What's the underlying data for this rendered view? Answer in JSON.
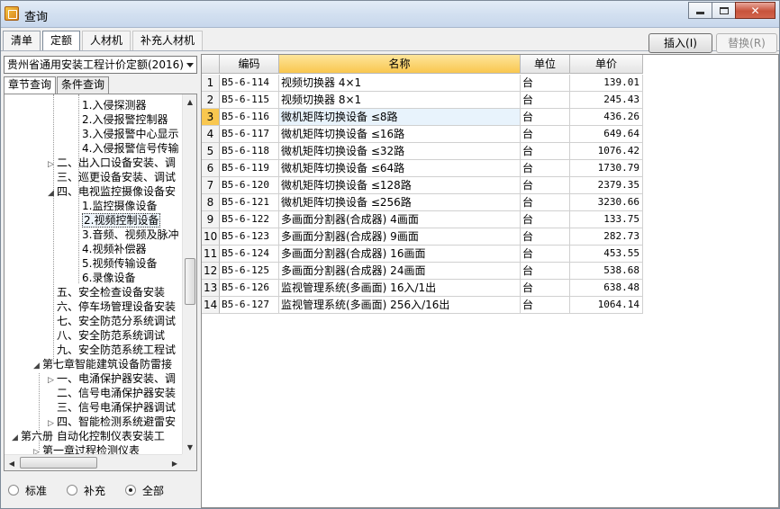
{
  "window": {
    "title": "查询"
  },
  "top_tabs": [
    "清单",
    "定额",
    "人材机",
    "补充人材机"
  ],
  "active_top_tab": "定额",
  "buttons": {
    "insert": "插入(I)",
    "replace": "替换(R)"
  },
  "left": {
    "quota_select": "贵州省通用安装工程计价定额(2016)",
    "tabs": [
      "章节查询",
      "条件查询"
    ],
    "active_tab": "章节查询",
    "tree": [
      "1.入侵探测器",
      "2.入侵报警控制器",
      "3.入侵报警中心显示",
      "4.入侵报警信号传输",
      "二、出入口设备安装、调",
      "三、巡更设备安装、调试",
      "四、电视监控摄像设备安",
      "1.监控摄像设备",
      "2.视频控制设备",
      "3.音频、视频及脉冲",
      "4.视频补偿器",
      "5.视频传输设备",
      "6.录像设备",
      "五、安全检查设备安装",
      "六、停车场管理设备安装",
      "七、安全防范分系统调试",
      "八、安全防范系统调试",
      "九、安全防范系统工程试",
      "第七章智能建筑设备防雷接",
      "一、电涌保护器安装、调",
      "二、信号电涌保护器安装",
      "三、信号电涌保护器调试",
      "四、智能检测系统避雷安",
      "第六册 自动化控制仪表安装工",
      "第一章过程检测仪表"
    ],
    "radios": [
      "标准",
      "补充",
      "全部"
    ],
    "radio_selected": "全部"
  },
  "grid": {
    "columns": [
      "编码",
      "名称",
      "单位",
      "单价"
    ],
    "rows": [
      [
        "1",
        "B5-6-114",
        "视频切换器 4×1",
        "台",
        "139.01"
      ],
      [
        "2",
        "B5-6-115",
        "视频切换器 8×1",
        "台",
        "245.43"
      ],
      [
        "3",
        "B5-6-116",
        "微机矩阵切换设备 ≤8路",
        "台",
        "436.26"
      ],
      [
        "4",
        "B5-6-117",
        "微机矩阵切换设备 ≤16路",
        "台",
        "649.64"
      ],
      [
        "5",
        "B5-6-118",
        "微机矩阵切换设备 ≤32路",
        "台",
        "1076.42"
      ],
      [
        "6",
        "B5-6-119",
        "微机矩阵切换设备 ≤64路",
        "台",
        "1730.79"
      ],
      [
        "7",
        "B5-6-120",
        "微机矩阵切换设备 ≤128路",
        "台",
        "2379.35"
      ],
      [
        "8",
        "B5-6-121",
        "微机矩阵切换设备 ≤256路",
        "台",
        "3230.66"
      ],
      [
        "9",
        "B5-6-122",
        "多画面分割器(合成器) 4画面",
        "台",
        "133.75"
      ],
      [
        "10",
        "B5-6-123",
        "多画面分割器(合成器) 9画面",
        "台",
        "282.73"
      ],
      [
        "11",
        "B5-6-124",
        "多画面分割器(合成器) 16画面",
        "台",
        "453.55"
      ],
      [
        "12",
        "B5-6-125",
        "多画面分割器(合成器) 24画面",
        "台",
        "538.68"
      ],
      [
        "13",
        "B5-6-126",
        "监视管理系统(多画面) 16入/1出",
        "台",
        "638.48"
      ],
      [
        "14",
        "B5-6-127",
        "监视管理系统(多画面) 256入/16出",
        "台",
        "1064.14"
      ]
    ]
  }
}
